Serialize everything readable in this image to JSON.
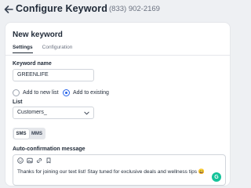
{
  "header": {
    "title": "Configure Keyword",
    "phone": "(833) 902-2169"
  },
  "card": {
    "title": "New keyword",
    "tabs": [
      {
        "label": "Settings",
        "active": true
      },
      {
        "label": "Configuration",
        "active": false
      }
    ]
  },
  "form": {
    "keyword_label": "Keyword name",
    "keyword_value": "GREENLIFE",
    "radio_options": [
      {
        "label": "Add to new list",
        "checked": false
      },
      {
        "label": "Add to existing",
        "checked": true
      }
    ],
    "list_label": "List",
    "list_value": "Customers_",
    "channel_options": [
      {
        "label": "SMS",
        "active": true
      },
      {
        "label": "MMS",
        "active": false
      }
    ],
    "auto_msg_label": "Auto-confirmation message",
    "auto_msg_text": "Thanks for joining our text list! Stay tuned for exclusive deals and wellness tips 😀",
    "grammarly_letter": "G"
  },
  "toolbar_icons": [
    "emoji-icon",
    "image-icon",
    "link-icon",
    "bookmark-icon"
  ],
  "colors": {
    "accent": "#2563eb",
    "background": "#eef0f3",
    "grammarly": "#15c39a"
  }
}
